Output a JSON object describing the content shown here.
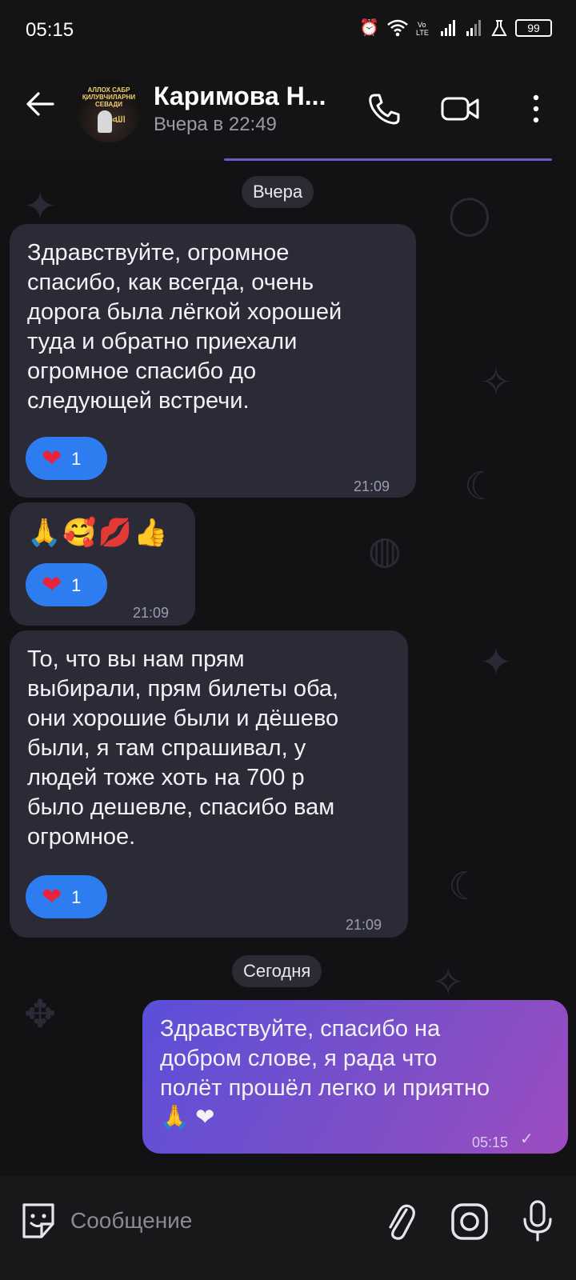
{
  "status_bar": {
    "time": "05:15",
    "battery": "99"
  },
  "header": {
    "contact_name": "Каримова Н...",
    "last_seen": "Вчера в 22:49",
    "avatar_text": "АЛЛОХ САБР ҚИЛУВЧИЛАРНИ СЕВАДИ"
  },
  "chat": {
    "date_yesterday": "Вчера",
    "date_today": "Сегодня",
    "messages": [
      {
        "text": "Здравствуйте, огромное\nспасибо, как всегда, очень\nдорога была лёгкой хорошей\nтуда и обратно приехали\nогромное спасибо до\nследующей встречи.",
        "time": "21:09",
        "reaction": "❤",
        "reaction_count": "1"
      },
      {
        "text": "🙏🥰💋👍",
        "time": "21:09",
        "reaction": "❤",
        "reaction_count": "1"
      },
      {
        "text": "То, что вы нам прям\nвыбирали, прям билеты оба,\nони хорошие были и дёшево\nбыли, я там спрашивал, у\nлюдей тоже хоть на 700 р\nбыло дешевле, спасибо вам\nогромное.",
        "time": "21:09",
        "reaction": "❤",
        "reaction_count": "1"
      },
      {
        "text": "Здравствуйте, спасибо на\nдобром слове, я рада что\nполёт прошёл легко и приятно\n🙏 ❤",
        "time": "05:15",
        "status": "✓"
      }
    ]
  },
  "input": {
    "placeholder": "Сообщение"
  },
  "colors": {
    "background": "#121214",
    "incoming_bubble": "#2a2b37",
    "outgoing_bubble_start": "#5b4fd9",
    "outgoing_bubble_end": "#9d4cc0",
    "reaction_chip": "#2d7cf0"
  },
  "icons": [
    "back-arrow-icon",
    "phone-icon",
    "video-camera-icon",
    "more-vertical-icon",
    "sticker-icon",
    "paperclip-icon",
    "instagram-camera-icon",
    "microphone-icon",
    "alarm-icon",
    "wifi-icon",
    "signal-icon",
    "battery-icon"
  ]
}
